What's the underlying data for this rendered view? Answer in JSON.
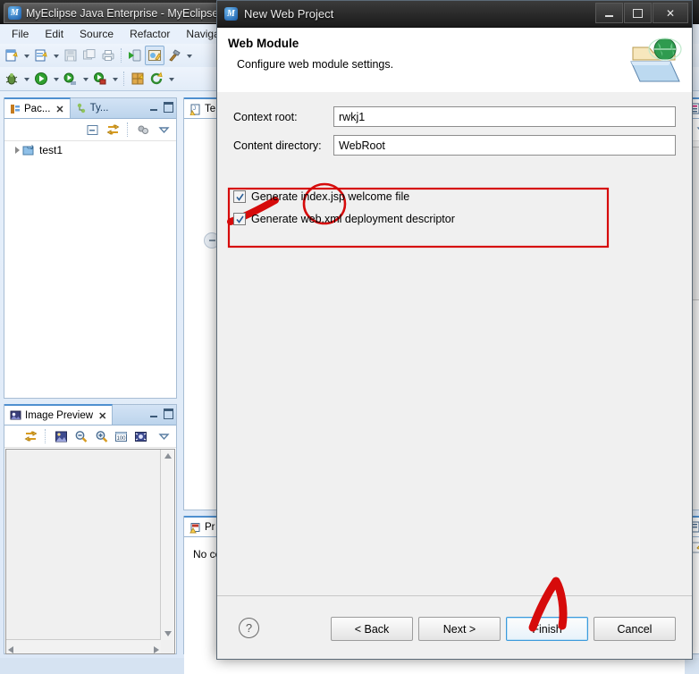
{
  "ide": {
    "title": "MyEclipse Java Enterprise - MyEclipse",
    "logo_text": "M",
    "menus": [
      "File",
      "Edit",
      "Source",
      "Refactor",
      "Navigate"
    ],
    "toolbar_row1": [
      {
        "name": "new-wizard-icon"
      },
      {
        "name": "dropdown-arrow-icon"
      },
      {
        "name": "new-java-class-icon"
      },
      {
        "name": "dropdown-arrow-icon"
      },
      {
        "name": "save-icon"
      },
      {
        "name": "save-all-icon"
      },
      {
        "name": "print-icon"
      },
      {
        "name": "separator"
      },
      {
        "name": "deploy-icon"
      },
      {
        "name": "manage-deployments-icon"
      },
      {
        "name": "build-hammer-icon"
      },
      {
        "name": "dropdown-arrow-icon"
      }
    ],
    "toolbar_row2": [
      {
        "name": "debug-bug-icon"
      },
      {
        "name": "dropdown-arrow-icon"
      },
      {
        "name": "run-icon"
      },
      {
        "name": "dropdown-arrow-icon"
      },
      {
        "name": "run-history-icon"
      },
      {
        "name": "dropdown-arrow-icon"
      },
      {
        "name": "external-tools-icon"
      },
      {
        "name": "dropdown-arrow-icon"
      },
      {
        "name": "separator"
      },
      {
        "name": "new-package-icon"
      },
      {
        "name": "refresh-icon"
      },
      {
        "name": "dropdown-arrow-icon"
      }
    ]
  },
  "package_explorer": {
    "tabs": [
      {
        "label": "Pac...",
        "active": true,
        "closable": true,
        "icon": "package-explorer-icon"
      },
      {
        "label": "Ty...",
        "active": false,
        "closable": false,
        "icon": "type-hierarchy-icon"
      }
    ],
    "toolbar": [
      "collapse-all-icon",
      "link-with-editor-icon",
      "view-filter-icon",
      "view-menu-icon"
    ],
    "tree": [
      {
        "label": "test1",
        "icon": "java-project-icon",
        "expandable": true
      }
    ]
  },
  "image_preview": {
    "tab_label": "Image Preview",
    "tab_icon": "image-preview-icon",
    "toolbar": [
      "link-with-editor-icon",
      "original-size-icon",
      "zoom-out-icon",
      "zoom-in-icon",
      "zoom-100-icon",
      "fit-to-window-icon",
      "view-menu-icon"
    ]
  },
  "editor": {
    "tab_label": "Te",
    "tab_icon": "java-file-warning-icon",
    "restore_icon": "minimize-editor-icon"
  },
  "problems": {
    "tab_label": "Pr",
    "tab_icon": "problems-icon",
    "body_text": "No co"
  },
  "outline": {
    "icon": "outline-icon",
    "menu_icon": "view-menu-icon"
  },
  "dialog": {
    "title": "New Web Project",
    "title_icon": "myeclipse-wizard-icon",
    "banner_icon": "web-module-folder-globe-icon",
    "heading": "Web Module",
    "subheading": "Configure web module settings.",
    "window_buttons": {
      "minimize": "minimize-icon",
      "maximize": "maximize-icon",
      "close": "✕"
    },
    "fields": [
      {
        "label": "Context root:",
        "value": "rwkj1",
        "placeholder": ""
      },
      {
        "label": "Content directory:",
        "value": "WebRoot",
        "placeholder": ""
      }
    ],
    "checkboxes": [
      {
        "label": "Generate index.jsp welcome file",
        "checked": true
      },
      {
        "label": "Generate web.xml deployment descriptor",
        "checked": true
      }
    ],
    "help_label": "?",
    "buttons": [
      {
        "label": "< Back",
        "focused": false,
        "enabled": true
      },
      {
        "label": "Next >",
        "focused": false,
        "enabled": true
      },
      {
        "label": "Finish",
        "focused": true,
        "enabled": true
      },
      {
        "label": "Cancel",
        "focused": false,
        "enabled": true
      }
    ]
  },
  "annotations": {
    "color": "#d60b0b",
    "shapes": [
      "highlight-rectangle",
      "highlight-circle",
      "pointer-stroke",
      "check-mark-stroke"
    ]
  }
}
